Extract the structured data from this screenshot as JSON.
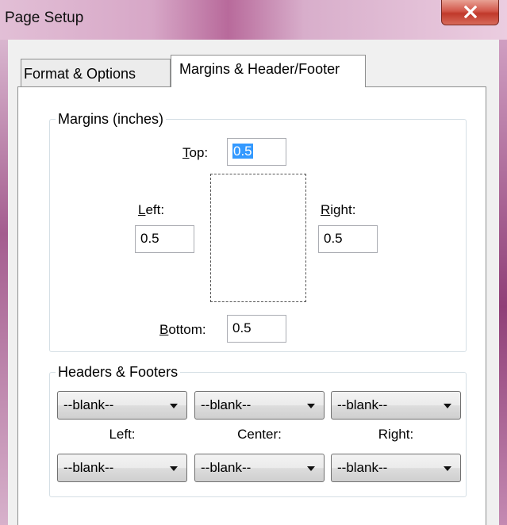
{
  "window": {
    "title": "Page Setup",
    "close_icon": "close-icon"
  },
  "tabs": [
    {
      "label": "Format & Options",
      "active": false
    },
    {
      "label": "Margins & Header/Footer",
      "active": true
    }
  ],
  "margins": {
    "group_title": "Margins (inches)",
    "top_label_key": "T",
    "top_label_rest": "op:",
    "top_value": "0.5",
    "left_label_key": "L",
    "left_label_rest": "eft:",
    "left_value": "0.5",
    "right_label_key": "R",
    "right_label_rest": "ight:",
    "right_value": "0.5",
    "bottom_label_key": "B",
    "bottom_label_rest": "ottom:",
    "bottom_value": "0.5"
  },
  "headers_footers": {
    "group_title": "Headers & Footers",
    "header_values": [
      "--blank--",
      "--blank--",
      "--blank--"
    ],
    "labels": [
      "Left:",
      "Center:",
      "Right:"
    ],
    "footer_values": [
      "--blank--",
      "--blank--",
      "--blank--"
    ]
  }
}
